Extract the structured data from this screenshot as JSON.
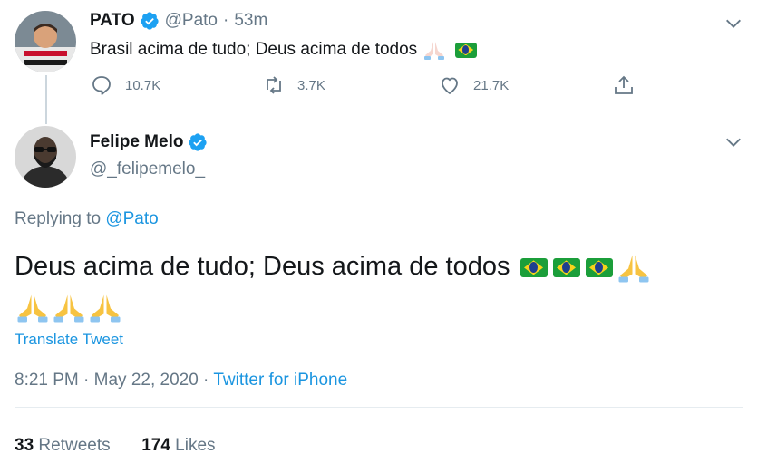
{
  "tweet_original": {
    "display_name": "PATO",
    "handle": "@Pato",
    "separator": "·",
    "time_ago": "53m",
    "text": "Brasil acima de tudo; Deus acima de todos",
    "emojis": [
      "folded-hands-light",
      "brazil-flag"
    ],
    "actions": {
      "reply_count": "10.7K",
      "retweet_count": "3.7K",
      "like_count": "21.7K"
    }
  },
  "tweet_reply": {
    "display_name": "Felipe Melo",
    "handle": "@_felipemelo_",
    "replying_prefix": "Replying to ",
    "replying_to": "@Pato",
    "text": "Deus acima de tudo; Deus acima de todos",
    "emojis": [
      "brazil-flag",
      "brazil-flag",
      "brazil-flag",
      "folded-hands",
      "folded-hands",
      "folded-hands",
      "folded-hands"
    ],
    "translate_label": "Translate Tweet",
    "timestamp": "8:21 PM · May 22, 2020",
    "meta_separator": " · ",
    "source": "Twitter for iPhone",
    "retweets_count": "33",
    "retweets_label": " Retweets",
    "likes_count": "174",
    "likes_label": " Likes"
  },
  "colors": {
    "accent": "#1b95e0",
    "verified": "#1da1f2",
    "muted": "#657786",
    "text": "#14171a"
  }
}
